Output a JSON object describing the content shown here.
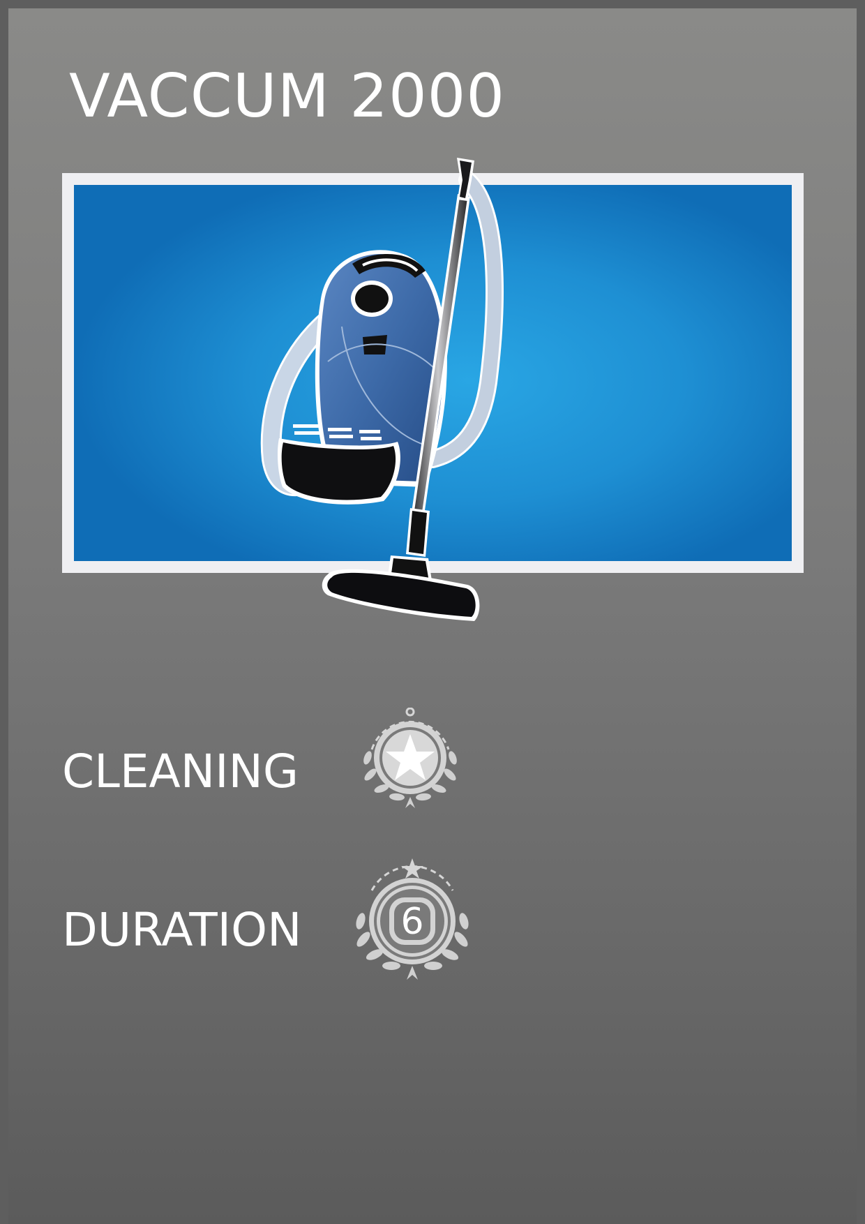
{
  "title": "VACCUM 2000",
  "stats": [
    {
      "label": "CLEANING",
      "badge_icon": "star-laurel-badge-icon"
    },
    {
      "label": "DURATION",
      "badge_icon": "number-laurel-badge-icon",
      "badge_value": "6"
    }
  ],
  "image": {
    "icon": "vacuum-cleaner-icon"
  },
  "colors": {
    "background_top": "#8a8a88",
    "background_bottom": "#5b5b5b",
    "frame": "#efeff2",
    "screen_center": "#29a6e4",
    "screen_edge": "#0f6db6",
    "badge": "#cfcfcf"
  }
}
